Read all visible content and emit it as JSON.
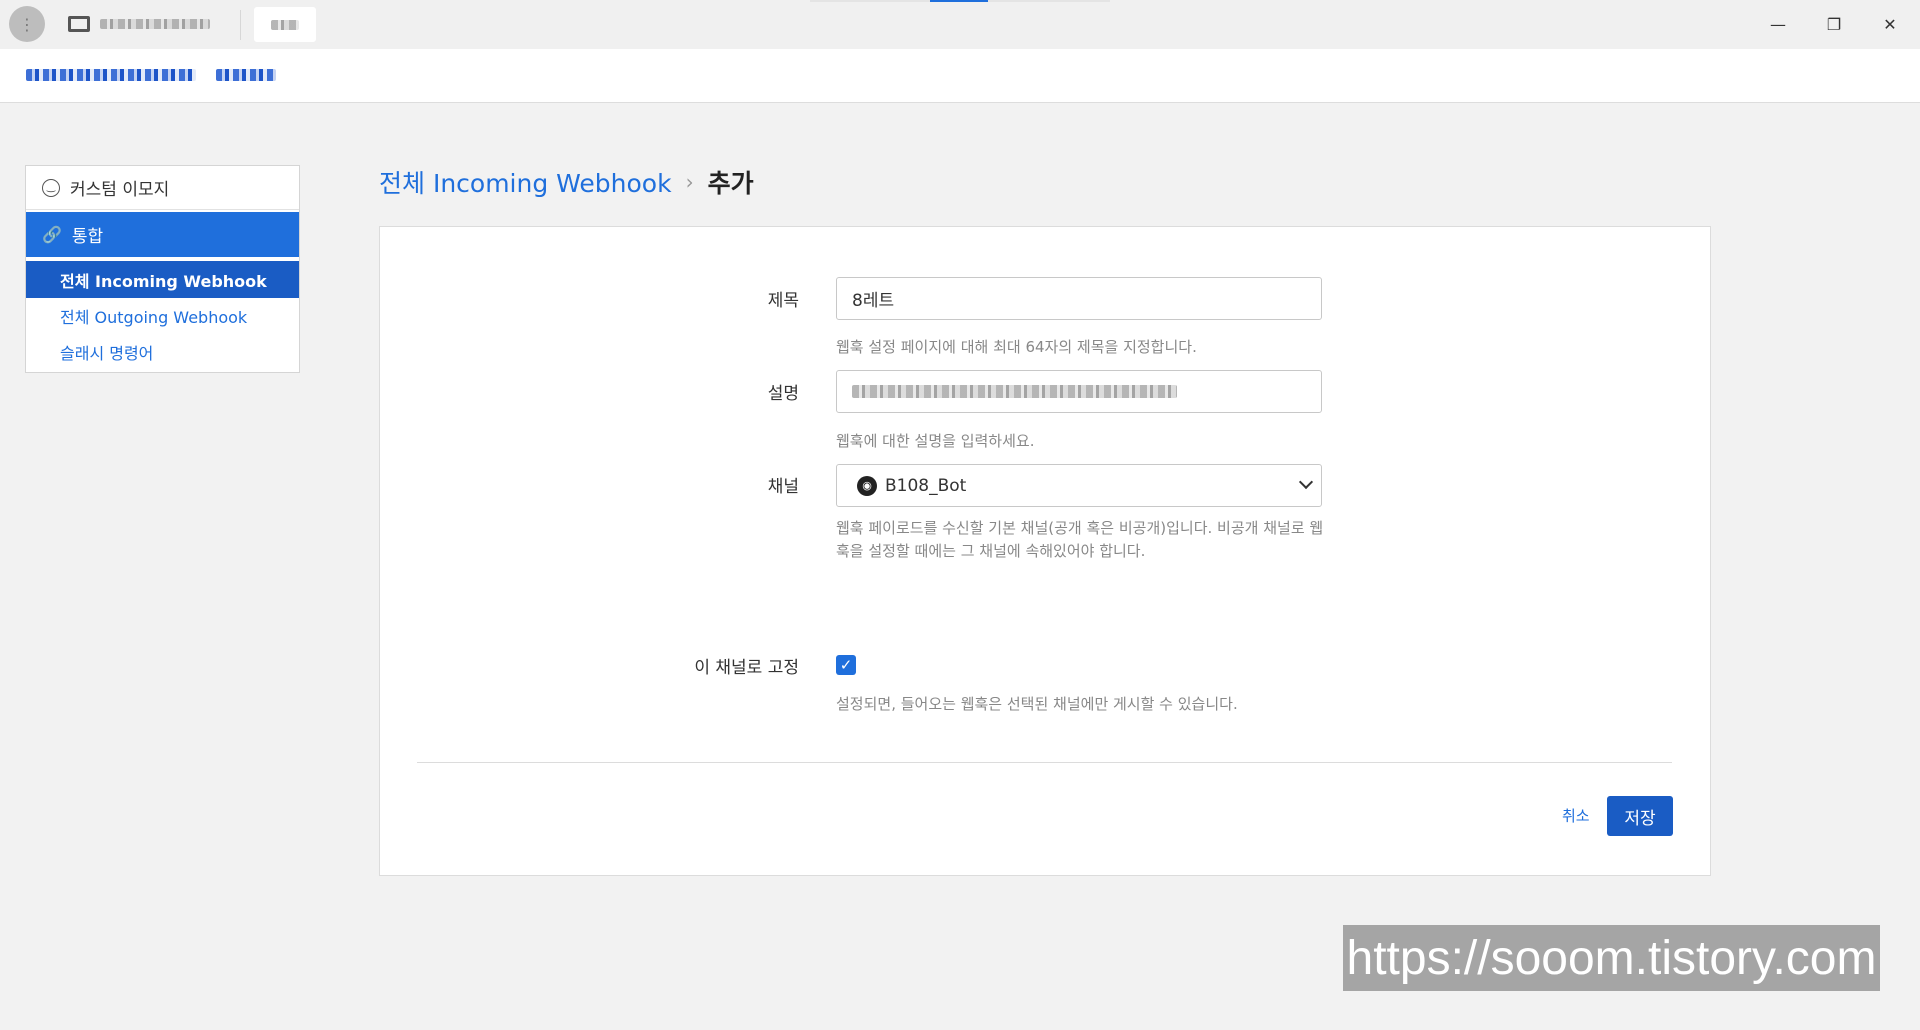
{
  "titlebar": {
    "avatar_icon": "user-avatar-icon",
    "server_icon": "server-icon",
    "window_controls": {
      "minimize": "—",
      "restore": "❐",
      "close": "✕"
    }
  },
  "sidebar": {
    "head": {
      "icon": "smiley-icon",
      "label": "커스텀 이모지"
    },
    "category": {
      "icon": "link-icon",
      "label": "통합"
    },
    "items": [
      {
        "label": "전체 Incoming Webhook",
        "active": true
      },
      {
        "label": "전체 Outgoing Webhook",
        "active": false
      },
      {
        "label": "슬래시 명령어",
        "active": false
      }
    ]
  },
  "page": {
    "breadcrumb_link": "전체 Incoming Webhook",
    "breadcrumb_current": "추가"
  },
  "form": {
    "title": {
      "label": "제목",
      "value": "8레트",
      "help": "웹훅 설정 페이지에 대해 최대 64자의 제목을 지정합니다."
    },
    "description": {
      "label": "설명",
      "help": "웹훅에 대한 설명을 입력하세요."
    },
    "channel": {
      "label": "채널",
      "value": "B108_Bot",
      "help": "웹훅 페이로드를 수신할 기본 채널(공개 혹은 비공개)입니다. 비공개 채널로 웹훅을 설정할 때에는 그 채널에 속해있어야 합니다."
    },
    "lock": {
      "label": "이 채널로 고정",
      "checked": true,
      "help": "설정되면, 들어오는 웹훅은 선택된 채널에만 게시할 수 있습니다."
    }
  },
  "actions": {
    "cancel": "취소",
    "save": "저장"
  },
  "watermark": "https://sooom.tistory.com",
  "colors": {
    "accent": "#1f6fdc",
    "accent_dark": "#1a5cc4"
  }
}
